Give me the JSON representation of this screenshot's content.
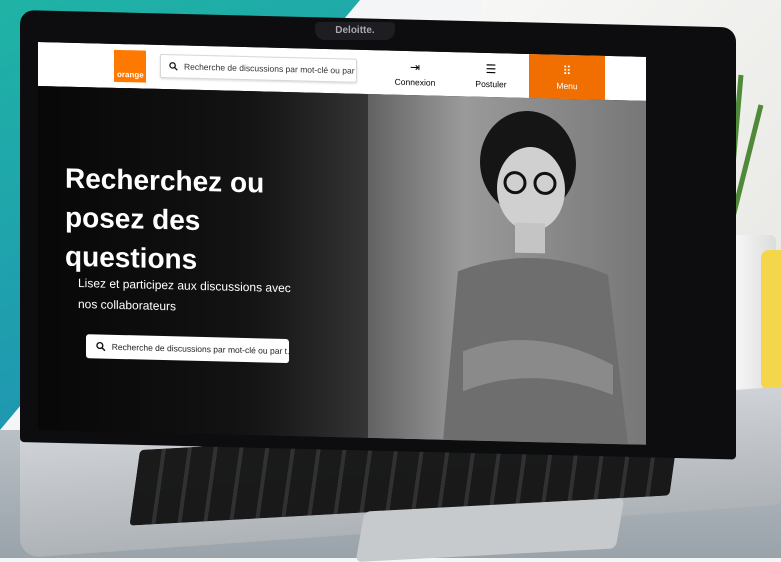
{
  "device": {
    "camera_label": "Deloitte."
  },
  "header": {
    "logo_text": "orange",
    "search": {
      "placeholder": "Recherche de discussions par mot-clé ou par thè..."
    },
    "nav": [
      {
        "label": "Connexion",
        "icon": "login-icon"
      },
      {
        "label": "Postuler",
        "icon": "document-icon"
      },
      {
        "label": "Menu",
        "icon": "grid-menu-icon"
      }
    ]
  },
  "hero": {
    "title": "Recherchez ou posez des questions",
    "subtitle": "Lisez et participez aux discussions avec nos collaborateurs",
    "search": {
      "placeholder": "Recherche de discussions par mot-clé ou par t..."
    }
  },
  "colors": {
    "brand_orange": "#ff7900",
    "menu_orange": "#f16e00",
    "teal_background": "#1fb3a5"
  }
}
